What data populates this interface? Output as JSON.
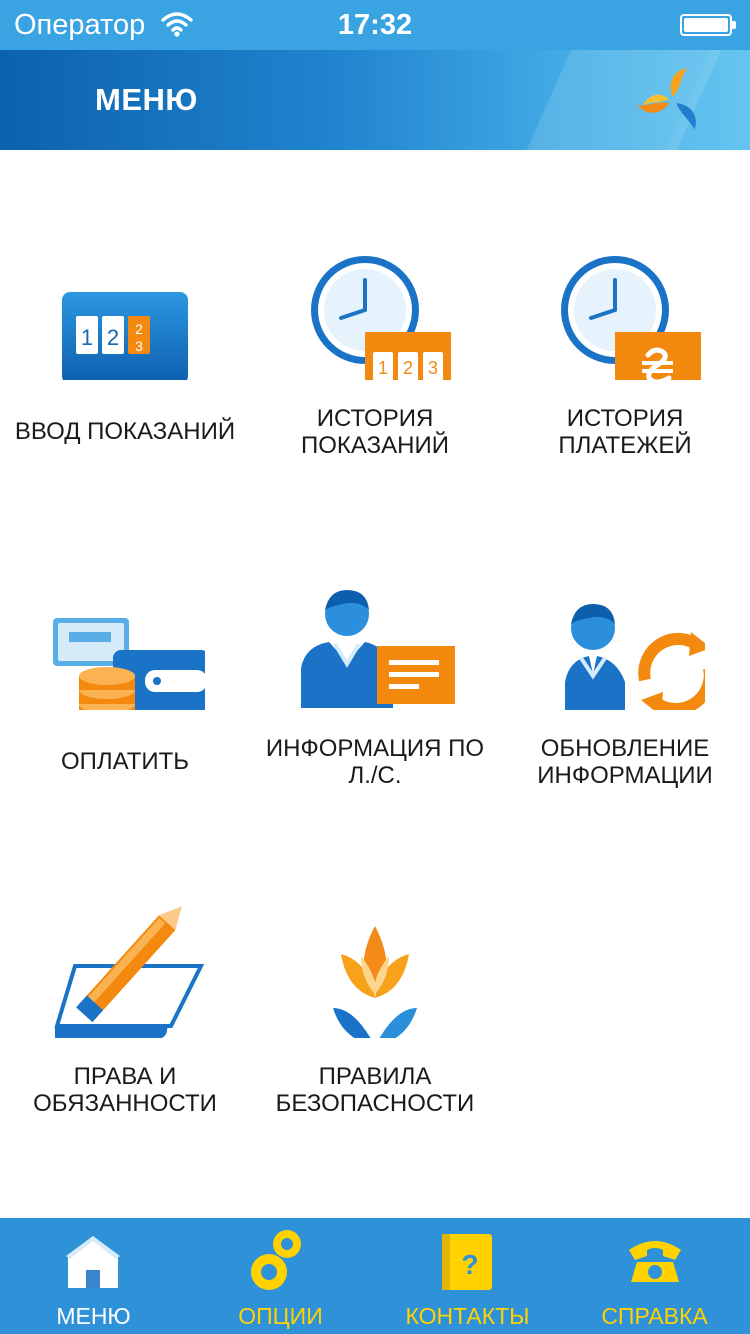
{
  "status_bar": {
    "carrier": "Оператор",
    "time": "17:32"
  },
  "header": {
    "title": "МЕНЮ"
  },
  "menu_items": [
    {
      "label": "ВВОД ПОКАЗАНИЙ",
      "icon": "meter-counter-icon"
    },
    {
      "label": "ИСТОРИЯ ПОКАЗАНИЙ",
      "line1": "ИСТОРИЯ",
      "line2": "ПОКАЗАНИЙ",
      "icon": "clock-counter-icon"
    },
    {
      "label": "ИСТОРИЯ ПЛАТЕЖЕЙ",
      "line1": "ИСТОРИЯ",
      "line2": "ПЛАТЕЖЕЙ",
      "icon": "clock-hryvnia-icon"
    },
    {
      "label": "ОПЛАТИТЬ",
      "icon": "wallet-coins-icon"
    },
    {
      "label": "ИНФОРМАЦИЯ ПО Л./С.",
      "line1": "ИНФОРМАЦИЯ ПО",
      "line2": "Л./С.",
      "icon": "person-card-icon"
    },
    {
      "label": "ОБНОВЛЕНИЕ ИНФОРМАЦИИ",
      "line1": "ОБНОВЛЕНИЕ",
      "line2": "ИНФОРМАЦИИ",
      "icon": "person-refresh-icon"
    },
    {
      "label": "ПРАВА И ОБЯЗАННОСТИ",
      "line1": "ПРАВА И",
      "line2": "ОБЯЗАННОСТИ",
      "icon": "pencil-document-icon"
    },
    {
      "label": "ПРАВИЛА БЕЗОПАСНОСТИ",
      "line1": "ПРАВИЛА",
      "line2": "БЕЗОПАСНОСТИ",
      "icon": "flame-flower-icon"
    }
  ],
  "tabbar": [
    {
      "label": "МЕНЮ",
      "icon": "home-icon",
      "active": true
    },
    {
      "label": "ОПЦИИ",
      "icon": "gears-icon",
      "active": false
    },
    {
      "label": "КОНТАКТЫ",
      "icon": "contacts-book-icon",
      "active": false
    },
    {
      "label": "СПРАВКА",
      "icon": "phone-icon",
      "active": false
    }
  ],
  "colors": {
    "primary_blue": "#1474c4",
    "accent_orange": "#f0820f",
    "tab_bar": "#2f91d8",
    "tab_inactive": "#ffd200"
  }
}
